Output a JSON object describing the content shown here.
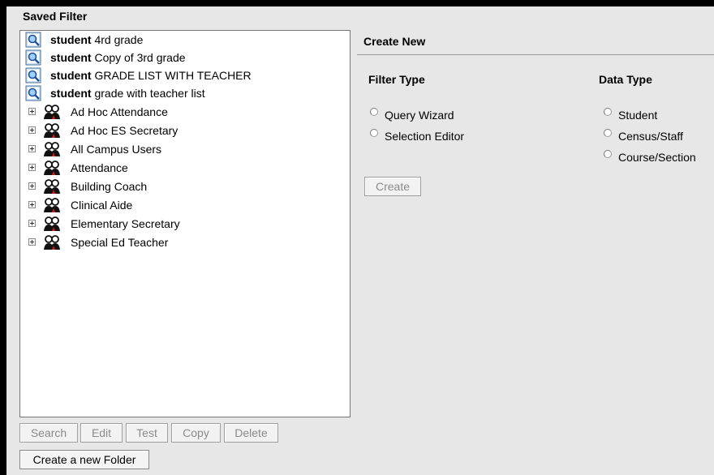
{
  "saved_filter": {
    "title": "Saved Filter",
    "filters": [
      {
        "type": "student",
        "name": "4rd grade"
      },
      {
        "type": "student",
        "name": "Copy of 3rd grade"
      },
      {
        "type": "student",
        "name": "GRADE LIST WITH TEACHER"
      },
      {
        "type": "student",
        "name": "grade with teacher list"
      }
    ],
    "groups": [
      "Ad Hoc Attendance",
      "Ad Hoc ES Secretary",
      "All Campus Users",
      "Attendance",
      "Building Coach",
      "Clinical Aide",
      "Elementary Secretary",
      "Special Ed Teacher"
    ],
    "buttons": {
      "search": "Search",
      "edit": "Edit",
      "test": "Test",
      "copy": "Copy",
      "delete": "Delete",
      "new_folder": "Create a new Folder"
    }
  },
  "create_new": {
    "title": "Create New",
    "filter_type_label": "Filter Type",
    "data_type_label": "Data Type",
    "filter_types": [
      "Query Wizard",
      "Selection Editor"
    ],
    "data_types": [
      "Student",
      "Census/Staff",
      "Course/Section"
    ],
    "create_label": "Create"
  },
  "icons": {
    "filter_icon": "query-magnifier-icon",
    "group_icon": "user-group-icon",
    "expander": "plus-expander-icon"
  }
}
